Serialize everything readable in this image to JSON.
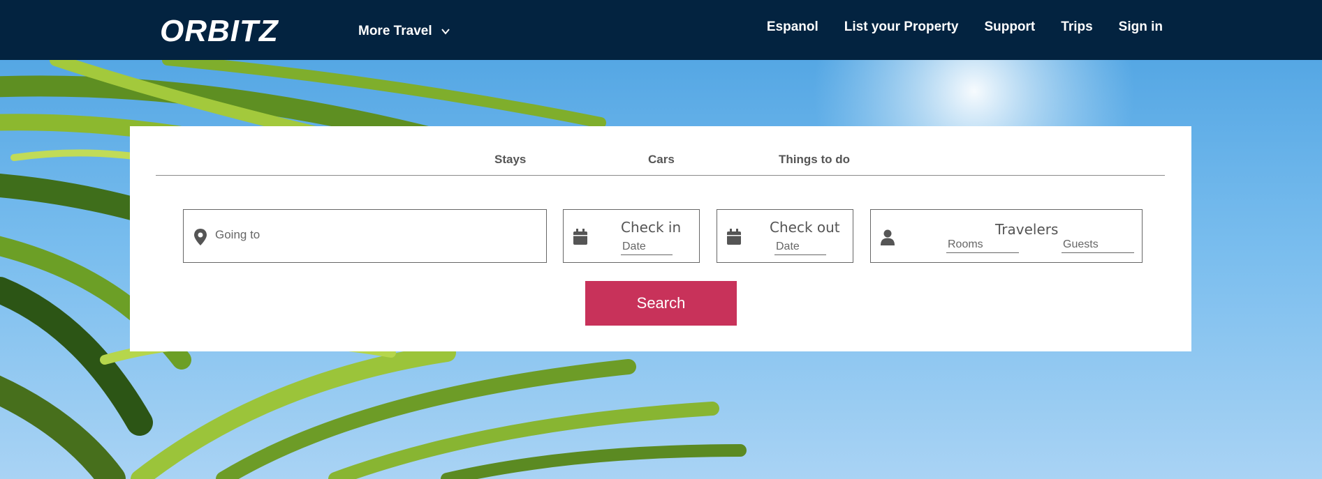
{
  "header": {
    "brand": "ORBITZ",
    "more_travel": "More Travel",
    "nav": [
      "Espanol",
      "List your Property",
      "Support",
      "Trips",
      "Sign in"
    ]
  },
  "tabs": [
    "Stays",
    "Cars",
    "Things to do"
  ],
  "search": {
    "going_placeholder": "Going to",
    "check_in_label": "Check in",
    "check_in_value": "Date",
    "check_out_label": "Check out",
    "check_out_value": "Date",
    "travelers_label": "Travelers",
    "rooms_value": "Rooms",
    "guests_value": "Guests",
    "button": "Search"
  },
  "colors": {
    "header_bg": "#032340",
    "search_button": "#c8325a"
  },
  "icons": [
    "chevron-down-icon",
    "map-pin-icon",
    "calendar-icon",
    "person-icon"
  ]
}
